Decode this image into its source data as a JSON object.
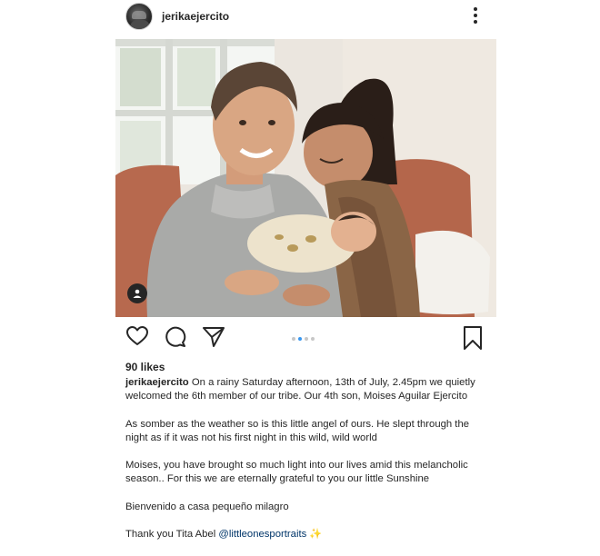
{
  "post": {
    "username": "jerikaejercito",
    "likes": "90 likes",
    "caption_first": "On a rainy Saturday afternoon, 13th of July, 2.45pm we quietly welcomed the 6th member of our tribe. Our 4th son, Moises Aguilar Ejercito",
    "paragraph_2": "As somber as the weather so is this little angel of ours. He slept through the night as if it was not his  first night in this wild, wild world",
    "paragraph_3": "Moises, you have brought so much light into our lives amid this melancholic season.. For this we are eternally grateful to you our little Sunshine",
    "paragraph_4": "Bienvenido a casa pequeño milagro",
    "thanks_text": "Thank you Tita Abel ",
    "mention": "@littleonesportraits",
    "sparkle": "✨",
    "carousel": {
      "total": 4,
      "active": 2
    }
  },
  "icons": {
    "more": "more-options-icon",
    "like": "heart-icon",
    "comment": "comment-icon",
    "share": "share-icon",
    "save": "bookmark-icon",
    "tag": "user-tag-icon"
  },
  "colors": {
    "text": "#262626",
    "link": "#003569",
    "carousel_active": "#3897f0",
    "carousel_inactive": "#c7c7c7"
  }
}
